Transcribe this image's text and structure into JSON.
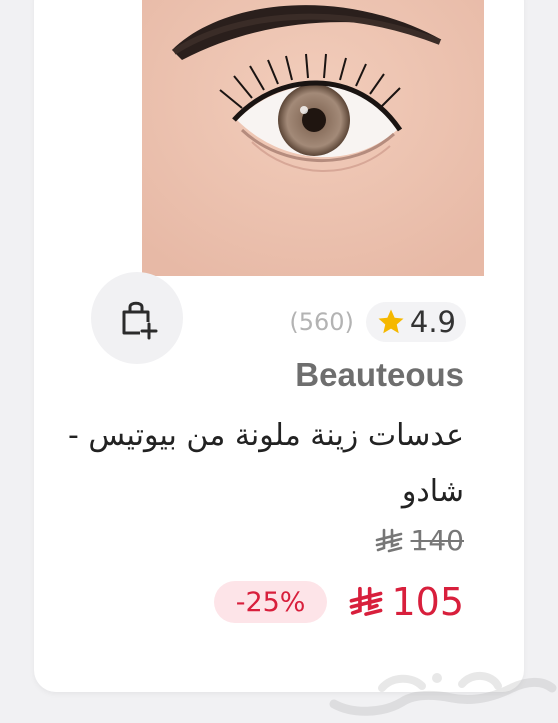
{
  "product": {
    "brand": "Beauteous",
    "title": "عدسات زينة ملونة من بيوتيس - شادو",
    "rating": "4.9",
    "review_count": "(560)",
    "old_price": "140",
    "new_price": "105",
    "discount": "-25%",
    "currency_icon": "riyal-icon",
    "image_subject": "eye-with-brown-colored-lens"
  },
  "actions": {
    "add_to_cart_icon": "shopping-bag-plus-icon"
  },
  "watermark": {
    "text": "حراج"
  },
  "colors": {
    "accent_red": "#d81f3c",
    "discount_bg": "#fde4e8",
    "brand_gray": "#6e6e6e",
    "star_yellow": "#f5b800"
  }
}
